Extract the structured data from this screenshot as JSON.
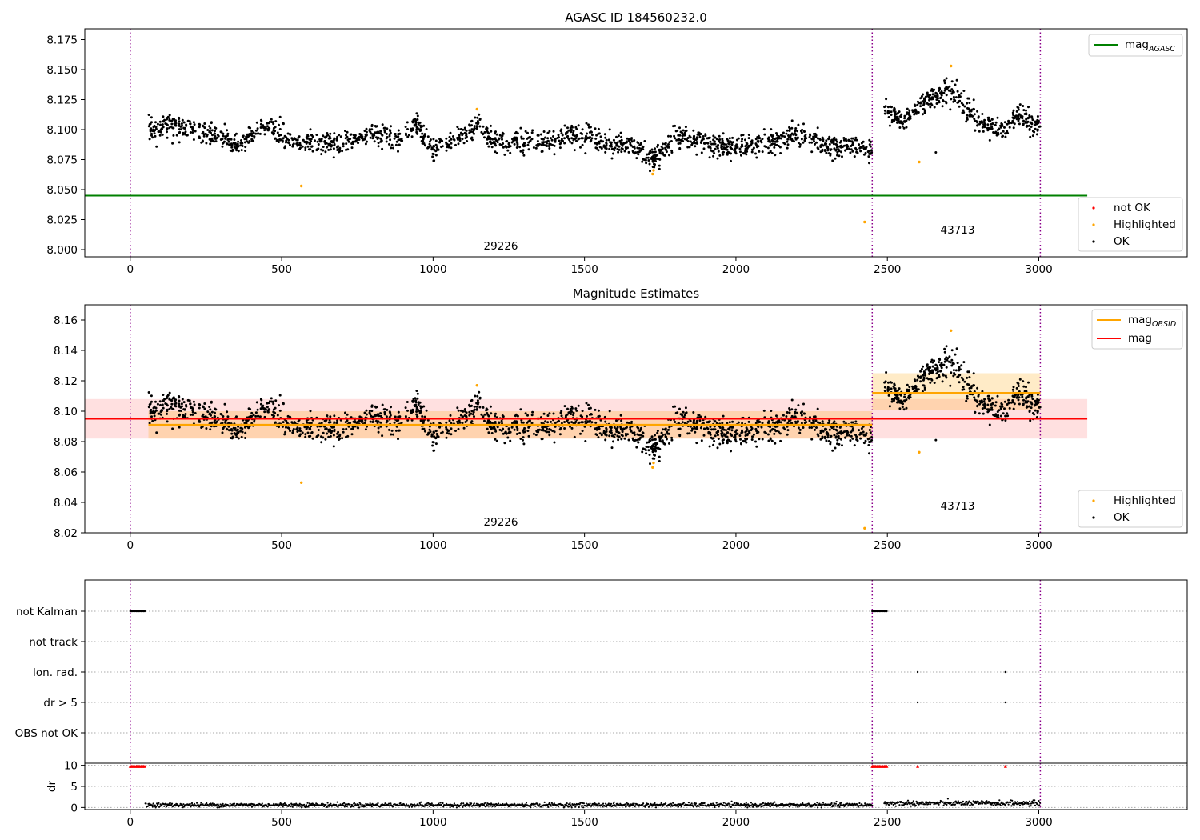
{
  "chart_data": [
    {
      "type": "scatter",
      "title": "AGASC ID 184560232.0",
      "xlim": [
        -150,
        3490
      ],
      "ylim": [
        7.994,
        8.184
      ],
      "xticks": [
        0,
        500,
        1000,
        1500,
        2000,
        2500,
        3000
      ],
      "xtick_labels": [
        "0",
        "500",
        "1000",
        "1500",
        "2000",
        "2500",
        "3000"
      ],
      "yticks": [
        8.0,
        8.025,
        8.05,
        8.075,
        8.1,
        8.125,
        8.15,
        8.175
      ],
      "ytick_labels": [
        "8.000",
        "8.025",
        "8.050",
        "8.075",
        "8.100",
        "8.125",
        "8.150",
        "8.175"
      ],
      "vlines": [
        0,
        2450,
        3005
      ],
      "obsid_labels": [
        {
          "text": "29226",
          "x": 1225,
          "y": 8.002
        },
        {
          "text": "43713",
          "x": 2725,
          "y": 8.015
        }
      ],
      "hlines": [
        {
          "name": "mag_AGASC",
          "value": 8.045,
          "x": [
            -150,
            3160
          ],
          "color": "#008000"
        }
      ],
      "legend_top": {
        "position": "top-right",
        "entries": [
          {
            "label": "mag",
            "sub": "AGASC",
            "kind": "line",
            "color": "#008000"
          }
        ]
      },
      "legend_bottom": {
        "position": "lower-right",
        "entries": [
          {
            "label": "not OK",
            "kind": "dot",
            "color": "#ff0000"
          },
          {
            "label": "Highlighted",
            "kind": "dot",
            "color": "#ffa500"
          },
          {
            "label": "OK",
            "kind": "dot",
            "color": "#000000"
          }
        ]
      },
      "highlighted_points": [
        [
          565,
          8.053
        ],
        [
          1145,
          8.117
        ],
        [
          1725,
          8.063
        ],
        [
          1728,
          8.066
        ],
        [
          2425,
          8.023
        ],
        [
          2605,
          8.073
        ],
        [
          2710,
          8.153
        ]
      ],
      "ok_points_series": {
        "source": "estimated",
        "segments": [
          {
            "x": [
              60,
              2450
            ],
            "n": 1750,
            "anchors": [
              [
                60,
                8.1
              ],
              [
                130,
                8.104
              ],
              [
                200,
                8.1
              ],
              [
                280,
                8.095
              ],
              [
                350,
                8.086
              ],
              [
                450,
                8.104
              ],
              [
                520,
                8.092
              ],
              [
                600,
                8.088
              ],
              [
                700,
                8.088
              ],
              [
                800,
                8.096
              ],
              [
                900,
                8.092
              ],
              [
                940,
                8.105
              ],
              [
                1000,
                8.082
              ],
              [
                1100,
                8.095
              ],
              [
                1150,
                8.105
              ],
              [
                1200,
                8.09
              ],
              [
                1300,
                8.09
              ],
              [
                1400,
                8.09
              ],
              [
                1450,
                8.097
              ],
              [
                1550,
                8.09
              ],
              [
                1650,
                8.088
              ],
              [
                1730,
                8.075
              ],
              [
                1800,
                8.095
              ],
              [
                1900,
                8.088
              ],
              [
                2000,
                8.085
              ],
              [
                2100,
                8.088
              ],
              [
                2200,
                8.097
              ],
              [
                2300,
                8.085
              ],
              [
                2400,
                8.088
              ],
              [
                2450,
                8.08
              ]
            ],
            "spread": 0.0045
          },
          {
            "x": [
              2490,
              3005
            ],
            "n": 420,
            "anchors": [
              [
                2490,
                8.12
              ],
              [
                2550,
                8.105
              ],
              [
                2600,
                8.118
              ],
              [
                2650,
                8.125
              ],
              [
                2700,
                8.133
              ],
              [
                2730,
                8.128
              ],
              [
                2780,
                8.11
              ],
              [
                2830,
                8.102
              ],
              [
                2880,
                8.1
              ],
              [
                2930,
                8.112
              ],
              [
                3005,
                8.1
              ]
            ],
            "spread": 0.005
          }
        ]
      },
      "extra_ok_points": [
        [
          2660,
          8.081
        ]
      ]
    },
    {
      "type": "scatter",
      "title": "Magnitude Estimates",
      "xlim": [
        -150,
        3490
      ],
      "ylim": [
        8.02,
        8.17
      ],
      "xticks": [
        0,
        500,
        1000,
        1500,
        2000,
        2500,
        3000
      ],
      "xtick_labels": [
        "0",
        "500",
        "1000",
        "1500",
        "2000",
        "2500",
        "3000"
      ],
      "yticks": [
        8.02,
        8.04,
        8.06,
        8.08,
        8.1,
        8.12,
        8.14,
        8.16
      ],
      "ytick_labels": [
        "8.02",
        "8.04",
        "8.06",
        "8.08",
        "8.10",
        "8.12",
        "8.14",
        "8.16"
      ],
      "vlines": [
        0,
        2450,
        3005
      ],
      "obsid_labels": [
        {
          "text": "29226",
          "x": 1225,
          "y": 8.024
        },
        {
          "text": "43713",
          "x": 2725,
          "y": 8.035
        }
      ],
      "mag_obsid": [
        {
          "x": [
            60,
            2450
          ],
          "value": 8.091,
          "band": [
            8.082,
            8.1
          ]
        },
        {
          "x": [
            2450,
            3005
          ],
          "value": 8.112,
          "band": [
            8.101,
            8.125
          ]
        }
      ],
      "mag": {
        "value": 8.095,
        "band": [
          8.082,
          8.108
        ],
        "x": [
          -150,
          3160
        ]
      },
      "legend_top": {
        "position": "top-right",
        "entries": [
          {
            "label": "mag",
            "sub": "OBSID",
            "kind": "line",
            "color": "#ffa500"
          },
          {
            "label": "mag",
            "sub": "",
            "kind": "line",
            "color": "#ff0000"
          }
        ]
      },
      "legend_bottom": {
        "position": "lower-right",
        "entries": [
          {
            "label": "Highlighted",
            "kind": "dot",
            "color": "#ffa500"
          },
          {
            "label": "OK",
            "kind": "dot",
            "color": "#000000"
          }
        ]
      },
      "highlighted_points": [
        [
          565,
          8.053
        ],
        [
          1145,
          8.117
        ],
        [
          1725,
          8.063
        ],
        [
          1728,
          8.066
        ],
        [
          2425,
          8.023
        ],
        [
          2605,
          8.073
        ],
        [
          2710,
          8.153
        ]
      ]
    },
    {
      "type": "scatter",
      "title": "",
      "xlim": [
        -150,
        3490
      ],
      "categories": [
        "not Kalman",
        "not track",
        "Ion. rad.",
        "dr > 5",
        "OBS not OK"
      ],
      "flag_ranges": [
        {
          "category": "not Kalman",
          "x": [
            0,
            50
          ]
        },
        {
          "category": "not Kalman",
          "x": [
            2450,
            2500
          ]
        }
      ],
      "flag_points": [
        {
          "category": "Ion. rad.",
          "x": [
            2600,
            2890
          ]
        },
        {
          "category": "dr > 5",
          "x": [
            2600,
            2890
          ]
        }
      ]
    },
    {
      "type": "scatter",
      "title": "",
      "ylabel": "dr",
      "xlim": [
        -150,
        3490
      ],
      "ylim": [
        -0.5,
        10.5
      ],
      "xticks": [
        0,
        500,
        1000,
        1500,
        2000,
        2500,
        3000
      ],
      "xtick_labels": [
        "0",
        "500",
        "1000",
        "1500",
        "2000",
        "2500",
        "3000"
      ],
      "yticks": [
        0,
        5,
        10
      ],
      "ytick_labels": [
        "0",
        "5",
        "10"
      ],
      "vlines": [
        0,
        2450,
        3005
      ],
      "red_markers_ranges": [
        {
          "x": [
            0,
            50
          ],
          "y": 9.8
        },
        {
          "x": [
            2450,
            2500
          ],
          "y": 9.8
        }
      ],
      "red_markers_points": [
        [
          2600,
          9.8
        ],
        [
          2890,
          9.8
        ]
      ],
      "dr_segments": [
        {
          "x": [
            50,
            2450
          ],
          "mean": 0.6,
          "spread": 0.4
        },
        {
          "x": [
            2490,
            3005
          ],
          "mean": 1.0,
          "spread": 0.5
        }
      ]
    }
  ]
}
